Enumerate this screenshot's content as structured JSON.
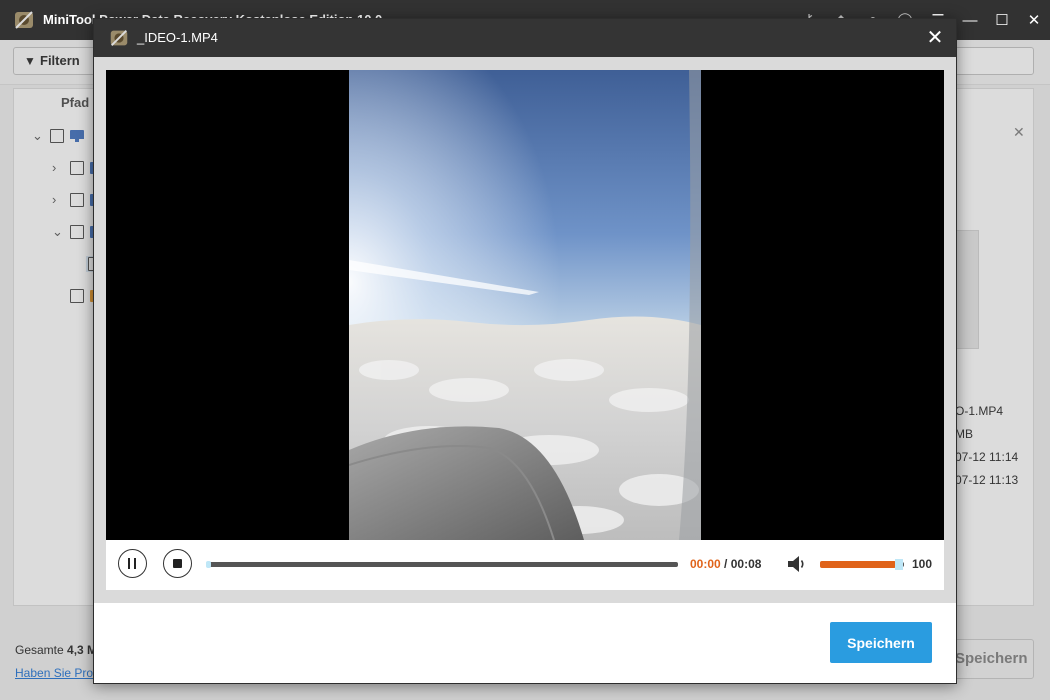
{
  "app": {
    "title": "MiniTool Power Data Recovery Kostenlose Edition 10.0",
    "filter_label": "Filtern",
    "path_header": "Pfad"
  },
  "tree": [
    {
      "icon": "monitor-icon",
      "color": "#4a78c2",
      "expanded": true
    },
    {
      "icon": "drive-icon",
      "color": "#4a78c2",
      "expanded": false
    },
    {
      "icon": "drive-icon",
      "color": "#4a78c2",
      "expanded": false
    },
    {
      "icon": "drive-icon",
      "color": "#4a78c2",
      "expanded": true
    },
    {
      "icon": "file-icon",
      "color": "#4a78c2",
      "expanded": false
    },
    {
      "icon": "folder-icon",
      "color": "#f0a030",
      "expanded": false
    }
  ],
  "details": {
    "name": "O-1.MP4",
    "size": "MB",
    "created": "07-12 11:14",
    "modified": "07-12 11:13"
  },
  "footer": {
    "total_label": "Gesamte",
    "total_value": "4,3 M",
    "help_link": "Haben Sie Pro",
    "bg_save": "Speichern"
  },
  "modal": {
    "title": "_IDEO-1.MP4",
    "save_label": "Speichern"
  },
  "player": {
    "current_time": "00:00",
    "separator": " / ",
    "duration": "00:08",
    "progress_percent": 1,
    "volume": "100",
    "volume_percent": 90
  },
  "colors": {
    "accent": "#2a9ce0",
    "time_current": "#e0631a",
    "volume_fill": "#e0631a",
    "titlebar": "#343434"
  }
}
